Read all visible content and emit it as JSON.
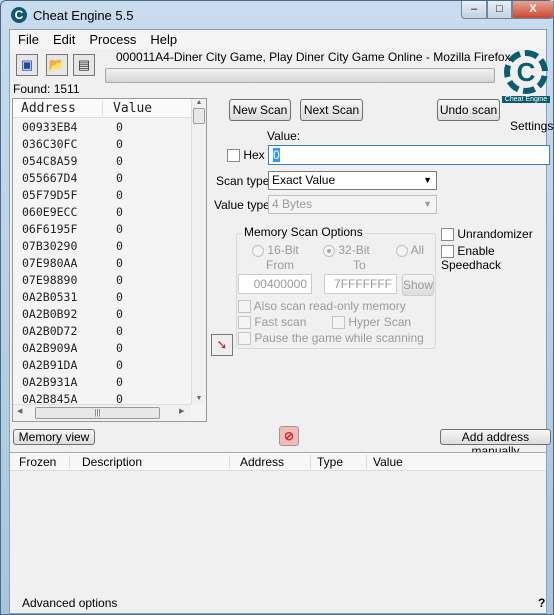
{
  "window": {
    "title": "Cheat Engine 5.5",
    "min": "–",
    "max": "□",
    "close": "X"
  },
  "menu": [
    "File",
    "Edit",
    "Process",
    "Help"
  ],
  "process_name": "000011A4-Diner City Game, Play Diner City Game Online - Mozilla Firefox",
  "found_label": "Found: 1511",
  "results": {
    "headers": [
      "Address",
      "Value"
    ],
    "rows": [
      [
        "00933EB4",
        "0"
      ],
      [
        "036C30FC",
        "0"
      ],
      [
        "054C8A59",
        "0"
      ],
      [
        "055667D4",
        "0"
      ],
      [
        "05F79D5F",
        "0"
      ],
      [
        "060E9ECC",
        "0"
      ],
      [
        "06F6195F",
        "0"
      ],
      [
        "07B30290",
        "0"
      ],
      [
        "07E980AA",
        "0"
      ],
      [
        "07E98890",
        "0"
      ],
      [
        "0A2B0531",
        "0"
      ],
      [
        "0A2B0B92",
        "0"
      ],
      [
        "0A2B0D72",
        "0"
      ],
      [
        "0A2B909A",
        "0"
      ],
      [
        "0A2B91DA",
        "0"
      ],
      [
        "0A2B931A",
        "0"
      ],
      [
        "0A2B845A",
        "0"
      ]
    ]
  },
  "buttons": {
    "new_scan": "New Scan",
    "next_scan": "Next Scan",
    "undo_scan": "Undo scan",
    "settings": "Settings",
    "show": "Show",
    "memory_view": "Memory view",
    "add_address": "Add address manually"
  },
  "logo_text": "Cheat Engine",
  "scan": {
    "value_label": "Value:",
    "value": "0",
    "hex_label": "Hex",
    "hex_checked": false,
    "scan_type_label": "Scan type",
    "scan_type": "Exact Value",
    "value_type_label": "Value type",
    "value_type": "4 Bytes"
  },
  "memory_options": {
    "title": "Memory Scan Options",
    "r16": "16-Bit",
    "r32": "32-Bit",
    "rall": "All",
    "selected": "32-Bit",
    "from_label": "From",
    "to_label": "To",
    "from": "00400000",
    "to": "7FFFFFFF",
    "readonly": "Also scan read-only memory",
    "fast": "Fast scan",
    "hyper": "Hyper Scan",
    "pause": "Pause the game while scanning"
  },
  "unrandomizer": "Unrandomizer",
  "speedhack": "Enable Speedhack",
  "address_list": {
    "headers": [
      "Frozen",
      "Description",
      "Address",
      "Type",
      "Value"
    ]
  },
  "advanced": "Advanced options",
  "help": "?",
  "colors": {
    "accent": "#0c5b6e",
    "stop": "#c0282e"
  }
}
